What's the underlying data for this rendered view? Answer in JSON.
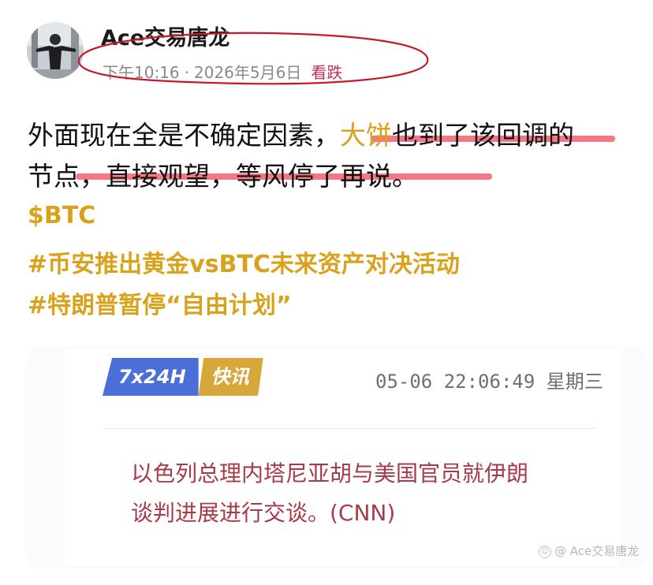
{
  "post": {
    "author": "Ace交易唐龙",
    "time": "下午10:16",
    "separator": "·",
    "date": "2026年5月6日",
    "stance": "看跌",
    "text": {
      "line1_before": "外面现在全是不确定因素，",
      "line1_highlight": "大饼",
      "line1_after": "也到了该回调的",
      "line2": "节点，直接观望，等风停了再说。"
    },
    "tags": [
      "$BTC",
      "#币安推出黄金vsBTC未来资产对决活动",
      "#特朗普暂停“自由计划”"
    ]
  },
  "news_card": {
    "badge_left": "7x24H",
    "badge_right": "快讯",
    "timestamp": "05-06 22:06:49 星期三",
    "body_line1": "以色列总理内塔尼亚胡与美国官员就伊朗",
    "body_line2": "谈判进展进行交谈。(CNN)"
  },
  "watermark": {
    "text": "@ Ace交易唐龙"
  },
  "colors": {
    "accent_gold": "#d9a21b",
    "stance_red": "#c0325a",
    "news_red": "#a83b4a",
    "badge_blue": "#4a6fd6",
    "badge_gold": "#d8a73a",
    "annotation_red": "#c8182a"
  },
  "icons": [
    "avatar-photo",
    "watermark-logo-icon"
  ]
}
